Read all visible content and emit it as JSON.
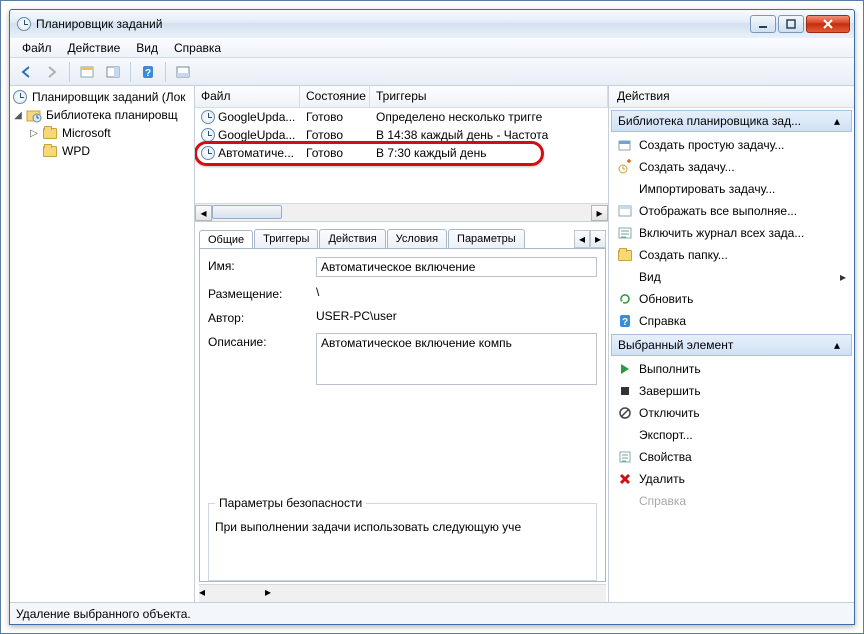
{
  "title": "Планировщик заданий",
  "menu": {
    "file": "Файл",
    "action": "Действие",
    "view": "Вид",
    "help": "Справка"
  },
  "tree": {
    "root": "Планировщик заданий (Лок",
    "lib": "Библиотека планировщ",
    "microsoft": "Microsoft",
    "wpd": "WPD"
  },
  "cols": {
    "file": "Файл",
    "state": "Состояние",
    "triggers": "Триггеры"
  },
  "tasks": [
    {
      "name": "GoogleUpda...",
      "state": "Готово",
      "trigger": "Определено несколько тригге"
    },
    {
      "name": "GoogleUpda...",
      "state": "Готово",
      "trigger": "В 14:38 каждый день - Частота"
    },
    {
      "name": "Автоматиче...",
      "state": "Готово",
      "trigger": "В 7:30 каждый день"
    }
  ],
  "tabs": {
    "general": "Общие",
    "triggers": "Триггеры",
    "actions": "Действия",
    "conditions": "Условия",
    "settings": "Параметры"
  },
  "det": {
    "name_l": "Имя:",
    "name_v": "Автоматическое включение",
    "loc_l": "Размещение:",
    "loc_v": "\\",
    "author_l": "Автор:",
    "author_v": "USER-PC\\user",
    "desc_l": "Описание:",
    "desc_v": "Автоматическое включение компь",
    "sec_l": "Параметры безопасности",
    "sec_line": "При выполнении задачи использовать следующую уче"
  },
  "act": {
    "header": "Действия",
    "grp1": "Библиотека планировщика зад...",
    "i1": "Создать простую задачу...",
    "i2": "Создать задачу...",
    "i3": "Импортировать задачу...",
    "i4": "Отображать все выполняе...",
    "i5": "Включить журнал всех зада...",
    "i6": "Создать папку...",
    "i7": "Вид",
    "i8": "Обновить",
    "i9": "Справка",
    "grp2": "Выбранный элемент",
    "j1": "Выполнить",
    "j2": "Завершить",
    "j3": "Отключить",
    "j4": "Экспорт...",
    "j5": "Свойства",
    "j6": "Удалить",
    "j7": "Справка"
  },
  "status": "Удаление выбранного объекта."
}
